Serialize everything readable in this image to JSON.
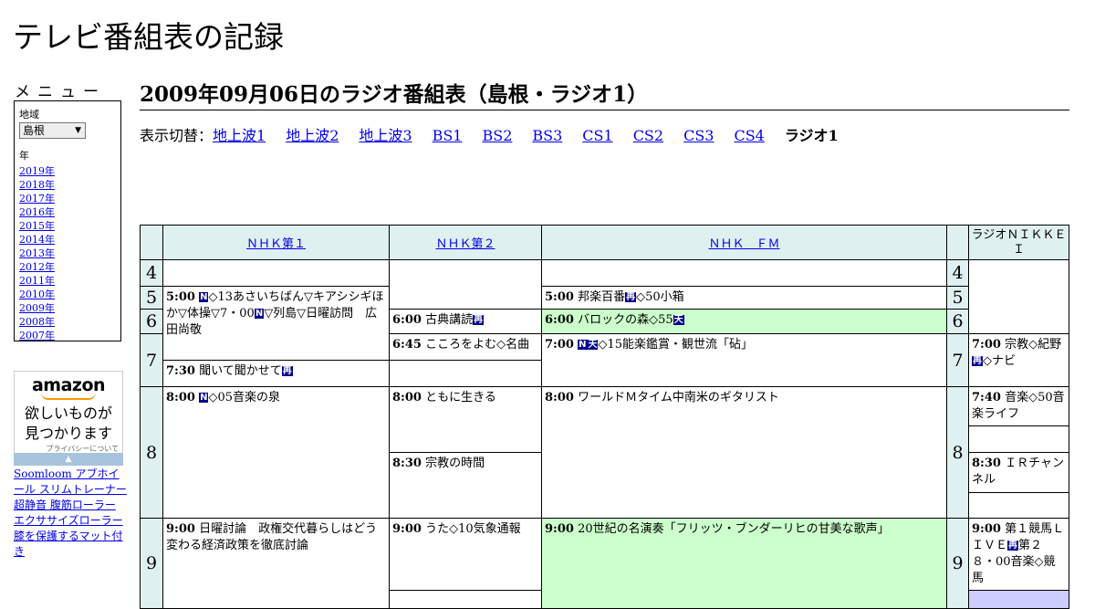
{
  "site_title": "テレビ番組表の記録",
  "menu": {
    "title": "メニュー",
    "region_label": "地域",
    "region_value": "島根",
    "year_label": "年",
    "years": [
      "2019年",
      "2018年",
      "2017年",
      "2016年",
      "2015年",
      "2014年",
      "2013年",
      "2012年",
      "2011年",
      "2010年",
      "2009年",
      "2008年",
      "2007年"
    ]
  },
  "ad": {
    "brand": "amazon",
    "copy_line1": "欲しいものが",
    "copy_line2": "見つかります",
    "privacy": "プライバシーについて",
    "links_text": "Soomloom アブホイール スリムトレーナー 超静音 腹筋ローラー エクササイズローラー 膝を保護するマット付き"
  },
  "page_title": "2009年09月06日のラジオ番組表（島根・ラジオ1）",
  "switcher": {
    "label": "表示切替：",
    "links": [
      "地上波1",
      "地上波2",
      "地上波3",
      "BS1",
      "BS2",
      "BS3",
      "CS1",
      "CS2",
      "CS3",
      "CS4"
    ],
    "current": "ラジオ1"
  },
  "channels": [
    "ＮＨＫ第１",
    "ＮＨＫ第２",
    "ＮＨＫ　ＦＭ",
    "ラジオＮＩＫＫＥＩ"
  ],
  "hours": [
    "4",
    "5",
    "6",
    "7",
    "8",
    "9"
  ],
  "programs": {
    "nhk1_5": {
      "time": "5:00",
      "text": "◇13あさいちばん▽キアシシギほか▽体操▽7・00",
      "text2": "▽列島▽日曜訪問　広田尚敬"
    },
    "nhk1_8": {
      "time": "8:00",
      "text": "◇05音楽の泉"
    },
    "nhk1_9": {
      "time": "9:00",
      "text": "日曜討論　政権交代暮らしはどう変わる経済政策を徹底討論"
    },
    "nhk2_6": {
      "time": "6:00",
      "text": "古典講読"
    },
    "nhk2_645": {
      "time": "6:45",
      "text": "こころをよむ◇名曲"
    },
    "nhk2_730": {
      "time": "7:30",
      "text": "聞いて聞かせて"
    },
    "nhk2_8": {
      "time": "8:00",
      "text": "ともに生きる"
    },
    "nhk2_830": {
      "time": "8:30",
      "text": "宗教の時間"
    },
    "nhk2_9": {
      "time": "9:00",
      "text": "うた◇10気象通報"
    },
    "fm_5": {
      "time": "5:00",
      "text": "邦楽百番",
      "text2": "◇50小箱"
    },
    "fm_6": {
      "time": "6:00",
      "text": "バロックの森◇55"
    },
    "fm_7": {
      "time": "7:00",
      "text": "◇15能楽鑑賞・観世流「砧」"
    },
    "fm_8": {
      "time": "8:00",
      "text": "ワールドＭタイム中南米のギタリスト"
    },
    "fm_9": {
      "time": "9:00",
      "text": "20世紀の名演奏「フリッツ・ブンダーリヒの甘美な歌声」"
    },
    "nikkei_7": {
      "time": "7:00",
      "text": "宗教◇紀野",
      "text2": "◇ナビ"
    },
    "nikkei_740": {
      "time": "7:40",
      "text": "音楽◇50音楽ライフ"
    },
    "nikkei_830": {
      "time": "8:30",
      "text": "ＩＲチャンネル"
    },
    "nikkei_9": {
      "time": "9:00",
      "text": "第１競馬ＬＩＶＥ",
      "text2": "第２８・00音楽◇競馬"
    }
  },
  "icons": {
    "news": "N",
    "re": "再",
    "ten": "天",
    "st": "ス"
  }
}
